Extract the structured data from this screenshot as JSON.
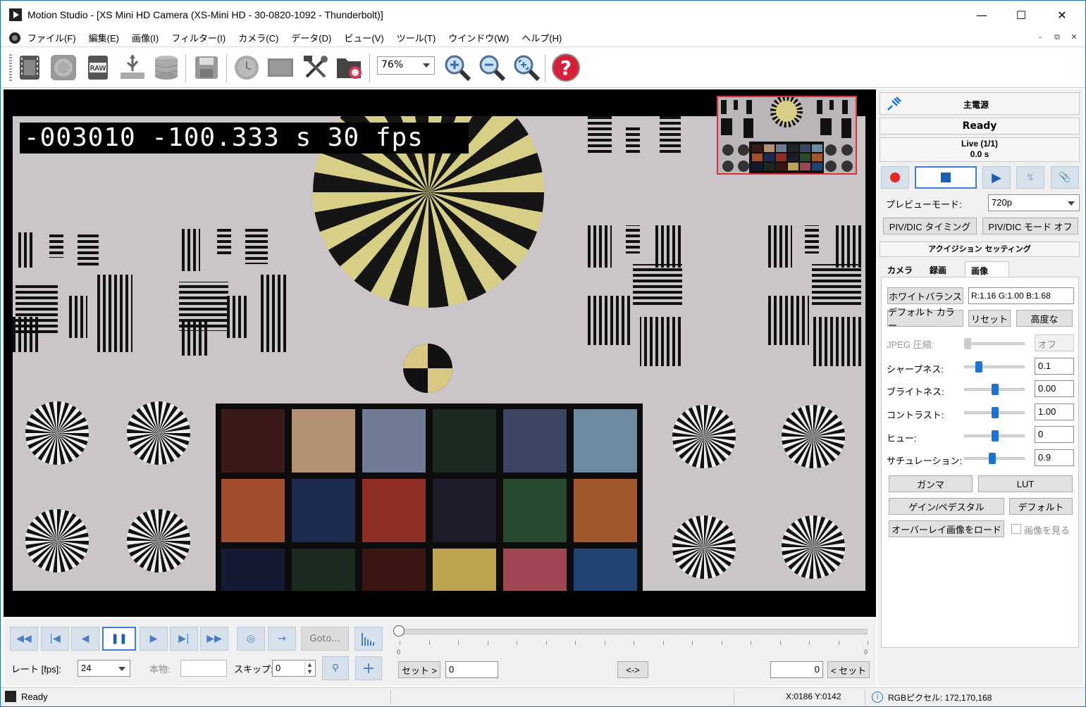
{
  "window": {
    "title": "Motion Studio - [XS Mini HD Camera (XS-Mini HD - 30-0820-1092 - Thunderbolt)]",
    "minimize": "—",
    "maximize": "☐",
    "close": "✕"
  },
  "menu": [
    "ファイル(F)",
    "編集(E)",
    "画像(I)",
    "フィルター(I)",
    "カメラ(C)",
    "データ(D)",
    "ビュー(V)",
    "ツール(T)",
    "ウインドウ(W)",
    "ヘルプ(H)"
  ],
  "mdi": {
    "minimize": "–",
    "restore": "⧉",
    "close": "✕"
  },
  "toolbar": {
    "zoom": "76%",
    "raw_label": "RAW",
    "icons": [
      "film-icon",
      "camera-lens-icon",
      "raw-icon",
      "usb-icon",
      "database-icon",
      "save-icon",
      "clock-icon",
      "monitor-icon",
      "tools-icon",
      "folder-record-icon",
      "zoom-in-icon",
      "zoom-out-icon",
      "zoom-fit-icon",
      "help-icon"
    ]
  },
  "viewer": {
    "timestamp": "-003010 -100.333 s 30 fps"
  },
  "transport": {
    "rate_label": "レート [fps]:",
    "rate_value": "24",
    "real_label": "本物:",
    "real_value": "",
    "skip_label": "スキップ:",
    "skip_value": "0",
    "goto_label": "Goto...",
    "set_in_label": "セット >",
    "set_in_value": "0",
    "swap_label": "<->",
    "set_out_value": "0",
    "set_out_label": "< セット",
    "timeline_start": "0",
    "timeline_end": "0",
    "timeline_position": 0
  },
  "panel": {
    "power_label": "主電源",
    "status": "Ready",
    "live_line1": "Live (1/1)",
    "live_line2": "0.0 s",
    "preview_mode_label": "プレビューモード:",
    "preview_mode_value": "720p",
    "piv_timing_label": "PIV/DIC タイミング",
    "piv_mode_label": "PIV/DIC モード オフ",
    "acquisition_title": "アクイジション セッティング",
    "tabs": [
      "カメラ",
      "録画",
      "画像"
    ],
    "active_tab": "画像",
    "white_balance_label": "ホワイトバランス",
    "white_balance_value": "R:1.16  G:1.00  B:1.68",
    "default_color_label": "デフォルト カラー",
    "reset_label": "リセット",
    "advanced_label": "高度な",
    "jpeg_label": "JPEG 圧縮:",
    "jpeg_value": "オフ",
    "sharpness_label": "シャープネス:",
    "sharpness_value": "0.1",
    "brightness_label": "ブライトネス:",
    "brightness_value": "0.00",
    "contrast_label": "コントラスト:",
    "contrast_value": "1.00",
    "hue_label": "ヒュー:",
    "hue_value": "0",
    "saturation_label": "サチュレーション:",
    "saturation_value": "0.9",
    "gamma_label": "ガンマ",
    "lut_label": "LUT",
    "gain_pedestal_label": "ゲイン/ペデスタル",
    "default_label": "デフォルト",
    "overlay_load_label": "オーバーレイ画像をロード",
    "show_image_label": "画像を見る",
    "show_image_checked": false,
    "slider_levels": {
      "jpeg": 0.0,
      "sharpness": 0.2,
      "brightness": 0.5,
      "contrast": 0.5,
      "hue": 0.5,
      "saturation": 0.45
    }
  },
  "status": {
    "text": "Ready",
    "coords": "X:0186  Y:0142",
    "rgb": "RGBピクセル: 172,170,168"
  },
  "colors": {
    "accent": "#1c73d6",
    "record": "#e8261e",
    "thumb_border": "#e03030"
  }
}
